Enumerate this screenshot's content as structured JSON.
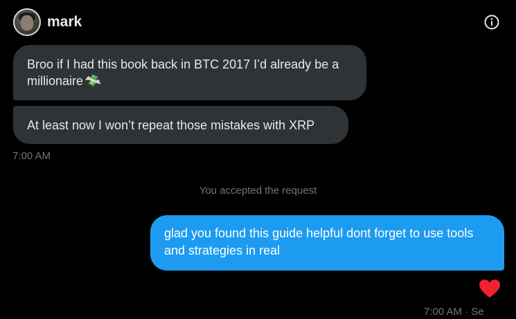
{
  "header": {
    "username": "mark",
    "avatar_icon": "user-avatar-photo",
    "info_icon": "info-icon"
  },
  "messages_in": [
    {
      "text": "Broo if I had this book back in BTC 2017 I’d already be a millionaire",
      "emoji": "💸"
    },
    {
      "text": "At least now I won’t repeat those mistakes with XRP"
    }
  ],
  "time_in": "7:00 AM",
  "system_note": "You accepted the request",
  "message_out": {
    "text": "glad you found this guide helpful dont forget to use tools and strategies in real",
    "reaction": "heart-icon"
  },
  "time_out": "7:00 AM · Se",
  "colors": {
    "background": "#000000",
    "incoming_bubble": "#2f3336",
    "outgoing_bubble": "#1d9bf0",
    "muted_text": "#71767b",
    "heart": "#f91880"
  }
}
